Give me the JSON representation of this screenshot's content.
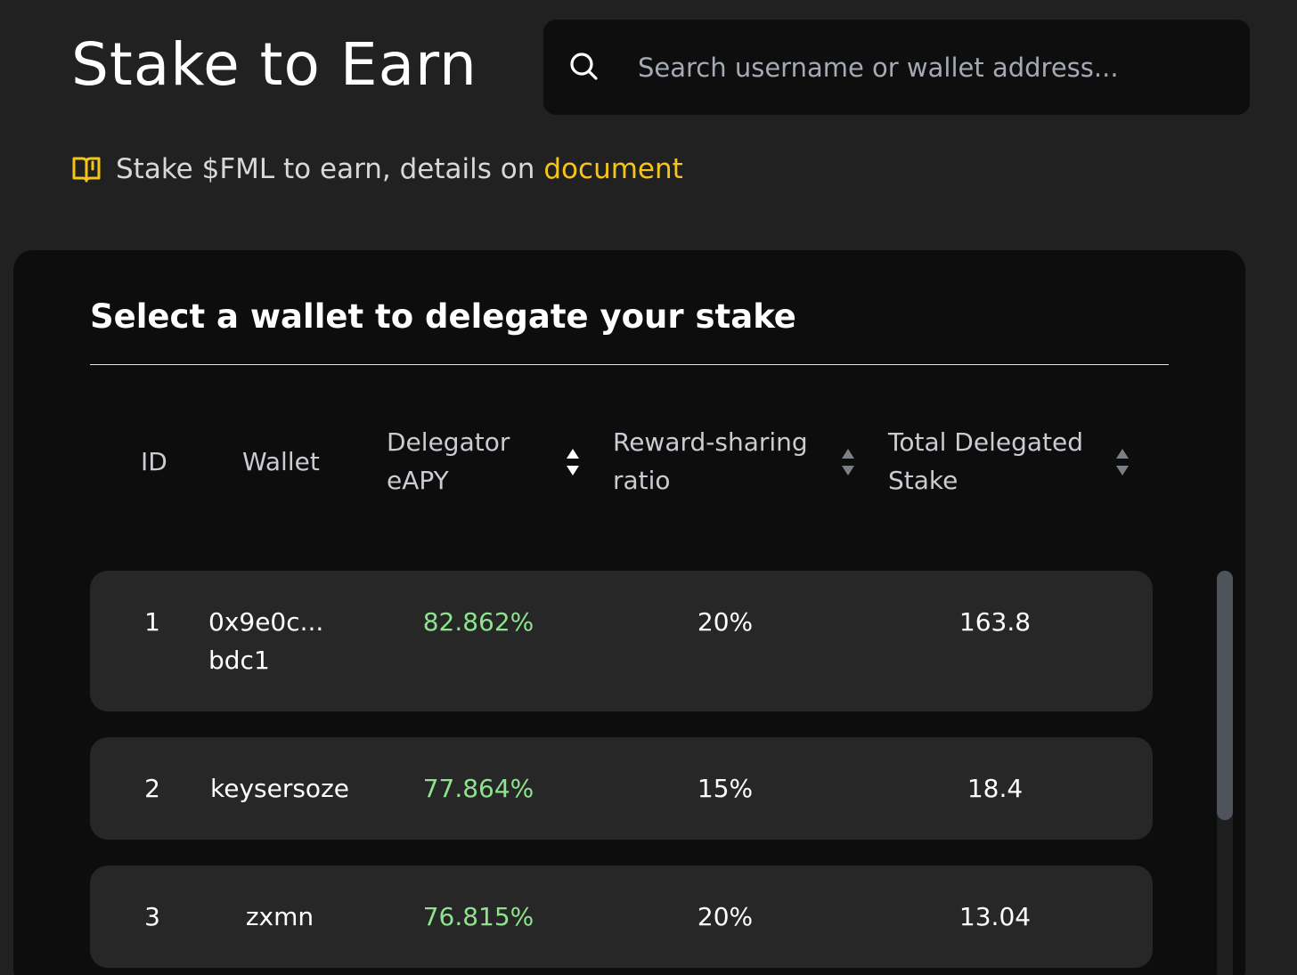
{
  "header": {
    "title": "Stake to Earn"
  },
  "search": {
    "placeholder": "Search username or wallet address..."
  },
  "notice": {
    "text": "Stake $FML to earn, details on",
    "link_label": "document"
  },
  "panel": {
    "heading": "Select a wallet to delegate your stake"
  },
  "table": {
    "columns": {
      "id": "ID",
      "wallet": "Wallet",
      "eapy": "Delegator eAPY",
      "ratio": "Reward-sharing ratio",
      "stake": "Total Delegated Stake"
    },
    "rows": [
      {
        "id": "1",
        "wallet": "0x9e0c...",
        "wallet_line2": "bdc1",
        "eapy": "82.862%",
        "ratio": "20%",
        "stake": "163.8"
      },
      {
        "id": "2",
        "wallet": "keysersoze",
        "eapy": "77.864%",
        "ratio": "15%",
        "stake": "18.4"
      },
      {
        "id": "3",
        "wallet": "zxmn",
        "eapy": "76.815%",
        "ratio": "20%",
        "stake": "13.04"
      }
    ]
  },
  "colors": {
    "background": "#212121",
    "panel": "#0d0d0d",
    "row": "#272727",
    "accent_link": "#f5c518",
    "eapy_green": "#8ee38f"
  },
  "icons": {
    "search": "search-icon",
    "notice": "book-icon",
    "sort": "sort-icon"
  }
}
